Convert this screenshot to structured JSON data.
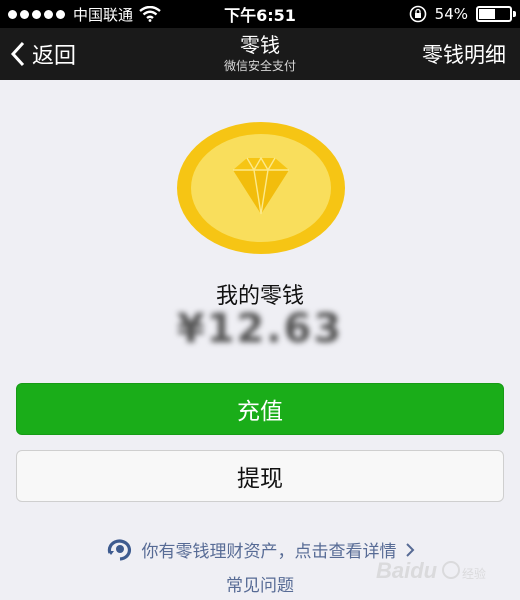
{
  "status_bar": {
    "carrier": "中国联通",
    "time": "下午6:51",
    "battery": "54%",
    "battery_level": 0.54,
    "icons": [
      "signal-dots",
      "wifi-icon",
      "lock-rotation-icon",
      "battery-icon"
    ]
  },
  "nav": {
    "back_label": "返回",
    "title": "零钱",
    "subtitle": "微信安全支付",
    "right_label": "零钱明细"
  },
  "wallet": {
    "label": "我的零钱",
    "balance": "¥12.63",
    "icon": "diamond-coin-icon"
  },
  "actions": {
    "recharge_label": "充值",
    "withdraw_label": "提现"
  },
  "links": {
    "finance_text": "你有零钱理财资产，点击查看详情",
    "faq": "常见问题"
  },
  "colors": {
    "accent_green": "#1aad19",
    "link_blue": "#576b95",
    "coin_yellow": "#f5c518"
  }
}
